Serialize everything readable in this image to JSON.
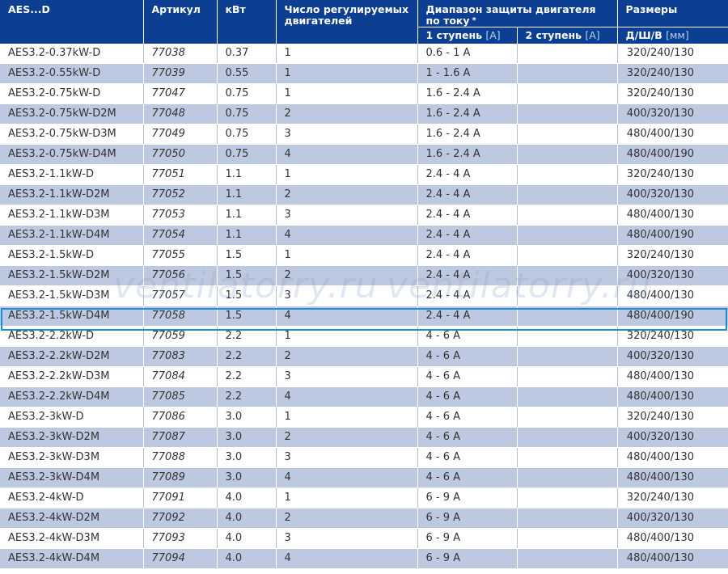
{
  "header": {
    "model": "AES...D",
    "article": "Артикул",
    "power": "кВт",
    "motors": "Число регулируемых двигателей",
    "range": "Диапазон защиты двигателя по току",
    "range_star": "*",
    "sizes": "Размеры",
    "stage1": "1 ступень",
    "stage1_unit": "[A]",
    "stage2": "2 ступень",
    "stage2_unit": "[A]",
    "dims": "Д/Ш/В",
    "dims_unit": "[мм]"
  },
  "watermark": "ventilatorry.ru",
  "rows": [
    {
      "model": "AES3.2-0.37kW-D",
      "article": "77038",
      "kw": "0.37",
      "motors": "1",
      "stage1": "0.6 - 1 A",
      "stage2": "",
      "dims": "320/240/130"
    },
    {
      "model": "AES3.2-0.55kW-D",
      "article": "77039",
      "kw": "0.55",
      "motors": "1",
      "stage1": "1 - 1.6 A",
      "stage2": "",
      "dims": "320/240/130"
    },
    {
      "model": "AES3.2-0.75kW-D",
      "article": "77047",
      "kw": "0.75",
      "motors": "1",
      "stage1": "1.6 - 2.4 A",
      "stage2": "",
      "dims": "320/240/130"
    },
    {
      "model": "AES3.2-0.75kW-D2M",
      "article": "77048",
      "kw": "0.75",
      "motors": "2",
      "stage1": "1.6 - 2.4 A",
      "stage2": "",
      "dims": "400/320/130"
    },
    {
      "model": "AES3.2-0.75kW-D3M",
      "article": "77049",
      "kw": "0.75",
      "motors": "3",
      "stage1": "1.6 - 2.4 A",
      "stage2": "",
      "dims": "480/400/130"
    },
    {
      "model": "AES3.2-0.75kW-D4M",
      "article": "77050",
      "kw": "0.75",
      "motors": "4",
      "stage1": "1.6 - 2.4 A",
      "stage2": "",
      "dims": "480/400/190"
    },
    {
      "model": "AES3.2-1.1kW-D",
      "article": "77051",
      "kw": "1.1",
      "motors": "1",
      "stage1": "2.4 - 4 A",
      "stage2": "",
      "dims": "320/240/130"
    },
    {
      "model": "AES3.2-1.1kW-D2M",
      "article": "77052",
      "kw": "1.1",
      "motors": "2",
      "stage1": "2.4 - 4 A",
      "stage2": "",
      "dims": "400/320/130"
    },
    {
      "model": "AES3.2-1.1kW-D3M",
      "article": "77053",
      "kw": "1.1",
      "motors": "3",
      "stage1": "2.4 - 4 A",
      "stage2": "",
      "dims": "480/400/130"
    },
    {
      "model": "AES3.2-1.1kW-D4M",
      "article": "77054",
      "kw": "1.1",
      "motors": "4",
      "stage1": "2.4 - 4 A",
      "stage2": "",
      "dims": "480/400/190"
    },
    {
      "model": "AES3.2-1.5kW-D",
      "article": "77055",
      "kw": "1.5",
      "motors": "1",
      "stage1": "2.4 - 4 A",
      "stage2": "",
      "dims": "320/240/130"
    },
    {
      "model": "AES3.2-1.5kW-D2M",
      "article": "77056",
      "kw": "1.5",
      "motors": "2",
      "stage1": "2.4 - 4 A",
      "stage2": "",
      "dims": "400/320/130"
    },
    {
      "model": "AES3.2-1.5kW-D3M",
      "article": "77057",
      "kw": "1.5",
      "motors": "3",
      "stage1": "2.4 - 4 A",
      "stage2": "",
      "dims": "480/400/130"
    },
    {
      "model": "AES3.2-1.5kW-D4M",
      "article": "77058",
      "kw": "1.5",
      "motors": "4",
      "stage1": "2.4 - 4 A",
      "stage2": "",
      "dims": "480/400/190"
    },
    {
      "model": "AES3.2-2.2kW-D",
      "article": "77059",
      "kw": "2.2",
      "motors": "1",
      "stage1": "4 - 6 A",
      "stage2": "",
      "dims": "320/240/130"
    },
    {
      "model": "AES3.2-2.2kW-D2M",
      "article": "77083",
      "kw": "2.2",
      "motors": "2",
      "stage1": "4 - 6 A",
      "stage2": "",
      "dims": "400/320/130"
    },
    {
      "model": "AES3.2-2.2kW-D3M",
      "article": "77084",
      "kw": "2.2",
      "motors": "3",
      "stage1": "4 - 6 A",
      "stage2": "",
      "dims": "480/400/130"
    },
    {
      "model": "AES3.2-2.2kW-D4M",
      "article": "77085",
      "kw": "2.2",
      "motors": "4",
      "stage1": "4 - 6 A",
      "stage2": "",
      "dims": "480/400/130"
    },
    {
      "model": "AES3.2-3kW-D",
      "article": "77086",
      "kw": "3.0",
      "motors": "1",
      "stage1": "4 - 6 A",
      "stage2": "",
      "dims": "320/240/130"
    },
    {
      "model": "AES3.2-3kW-D2M",
      "article": "77087",
      "kw": "3.0",
      "motors": "2",
      "stage1": "4 - 6 A",
      "stage2": "",
      "dims": "400/320/130"
    },
    {
      "model": "AES3.2-3kW-D3M",
      "article": "77088",
      "kw": "3.0",
      "motors": "3",
      "stage1": "4 - 6 A",
      "stage2": "",
      "dims": "480/400/130"
    },
    {
      "model": "AES3.2-3kW-D4M",
      "article": "77089",
      "kw": "3.0",
      "motors": "4",
      "stage1": "4 - 6 A",
      "stage2": "",
      "dims": "480/400/130"
    },
    {
      "model": "AES3.2-4kW-D",
      "article": "77091",
      "kw": "4.0",
      "motors": "1",
      "stage1": "6 - 9 A",
      "stage2": "",
      "dims": "320/240/130"
    },
    {
      "model": "AES3.2-4kW-D2M",
      "article": "77092",
      "kw": "4.0",
      "motors": "2",
      "stage1": "6 - 9 A",
      "stage2": "",
      "dims": "400/320/130"
    },
    {
      "model": "AES3.2-4kW-D3M",
      "article": "77093",
      "kw": "4.0",
      "motors": "3",
      "stage1": "6 - 9 A",
      "stage2": "",
      "dims": "480/400/130"
    },
    {
      "model": "AES3.2-4kW-D4M",
      "article": "77094",
      "kw": "4.0",
      "motors": "4",
      "stage1": "6 - 9 A",
      "stage2": "",
      "dims": "480/400/130"
    }
  ],
  "selected_row_index": 13,
  "colors": {
    "header_bg": "#0c3e91",
    "stripe": "#bdc8e1",
    "selection_border": "#1a8fd8"
  }
}
